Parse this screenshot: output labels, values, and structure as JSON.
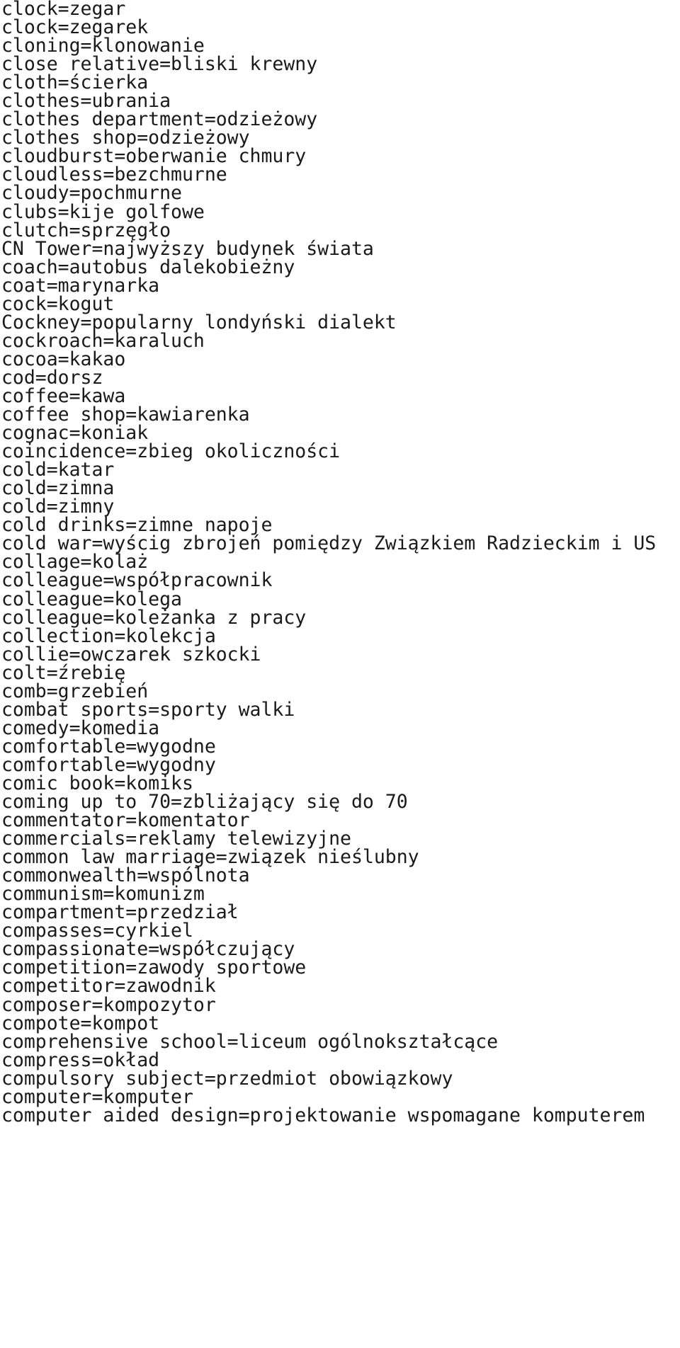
{
  "document": {
    "type": "dictionary-entry-list",
    "language_pair": "English-Polish",
    "text_color": "#1a1a1a",
    "background_color": "#ffffff",
    "entries": [
      "clock=zegar",
      "clock=zegarek",
      "cloning=klonowanie",
      "close relative=bliski krewny",
      "cloth=ścierka",
      "clothes=ubrania",
      "clothes department=odzieżowy",
      "clothes shop=odzieżowy",
      "cloudburst=oberwanie chmury",
      "cloudless=bezchmurne",
      "cloudy=pochmurne",
      "clubs=kije golfowe",
      "clutch=sprzęgło",
      "CN Tower=najwyższy budynek świata",
      "coach=autobus dalekobieżny",
      "coat=marynarka",
      "cock=kogut",
      "Cockney=popularny londyński dialekt",
      "cockroach=karaluch",
      "cocoa=kakao",
      "cod=dorsz",
      "coffee=kawa",
      "coffee shop=kawiarenka",
      "cognac=koniak",
      "coincidence=zbieg okoliczności",
      "cold=katar",
      "cold=zimna",
      "cold=zimny",
      "cold drinks=zimne napoje",
      "cold war=wyścig zbrojeń pomiędzy Związkiem Radzieckim i US",
      "collage=kolaż",
      "colleague=współpracownik",
      "colleague=kolega",
      "colleague=koleżanka z pracy",
      "collection=kolekcja",
      "collie=owczarek szkocki",
      "colt=źrebię",
      "comb=grzebień",
      "combat sports=sporty walki",
      "comedy=komedia",
      "comfortable=wygodne",
      "comfortable=wygodny",
      "comic book=komiks",
      "coming up to 70=zbliżający się do 70",
      "commentator=komentator",
      "commercials=reklamy telewizyjne",
      "common law marriage=związek nieślubny",
      "commonwealth=wspólnota",
      "communism=komunizm",
      "compartment=przedział",
      "compasses=cyrkiel",
      "compassionate=współczujący",
      "competition=zawody sportowe",
      "competitor=zawodnik",
      "composer=kompozytor",
      "compote=kompot",
      "comprehensive school=liceum ogólnokształcące",
      "compress=okład",
      "compulsory subject=przedmiot obowiązkowy",
      "computer=komputer",
      "computer aided design=projektowanie wspomagane komputerem"
    ]
  }
}
